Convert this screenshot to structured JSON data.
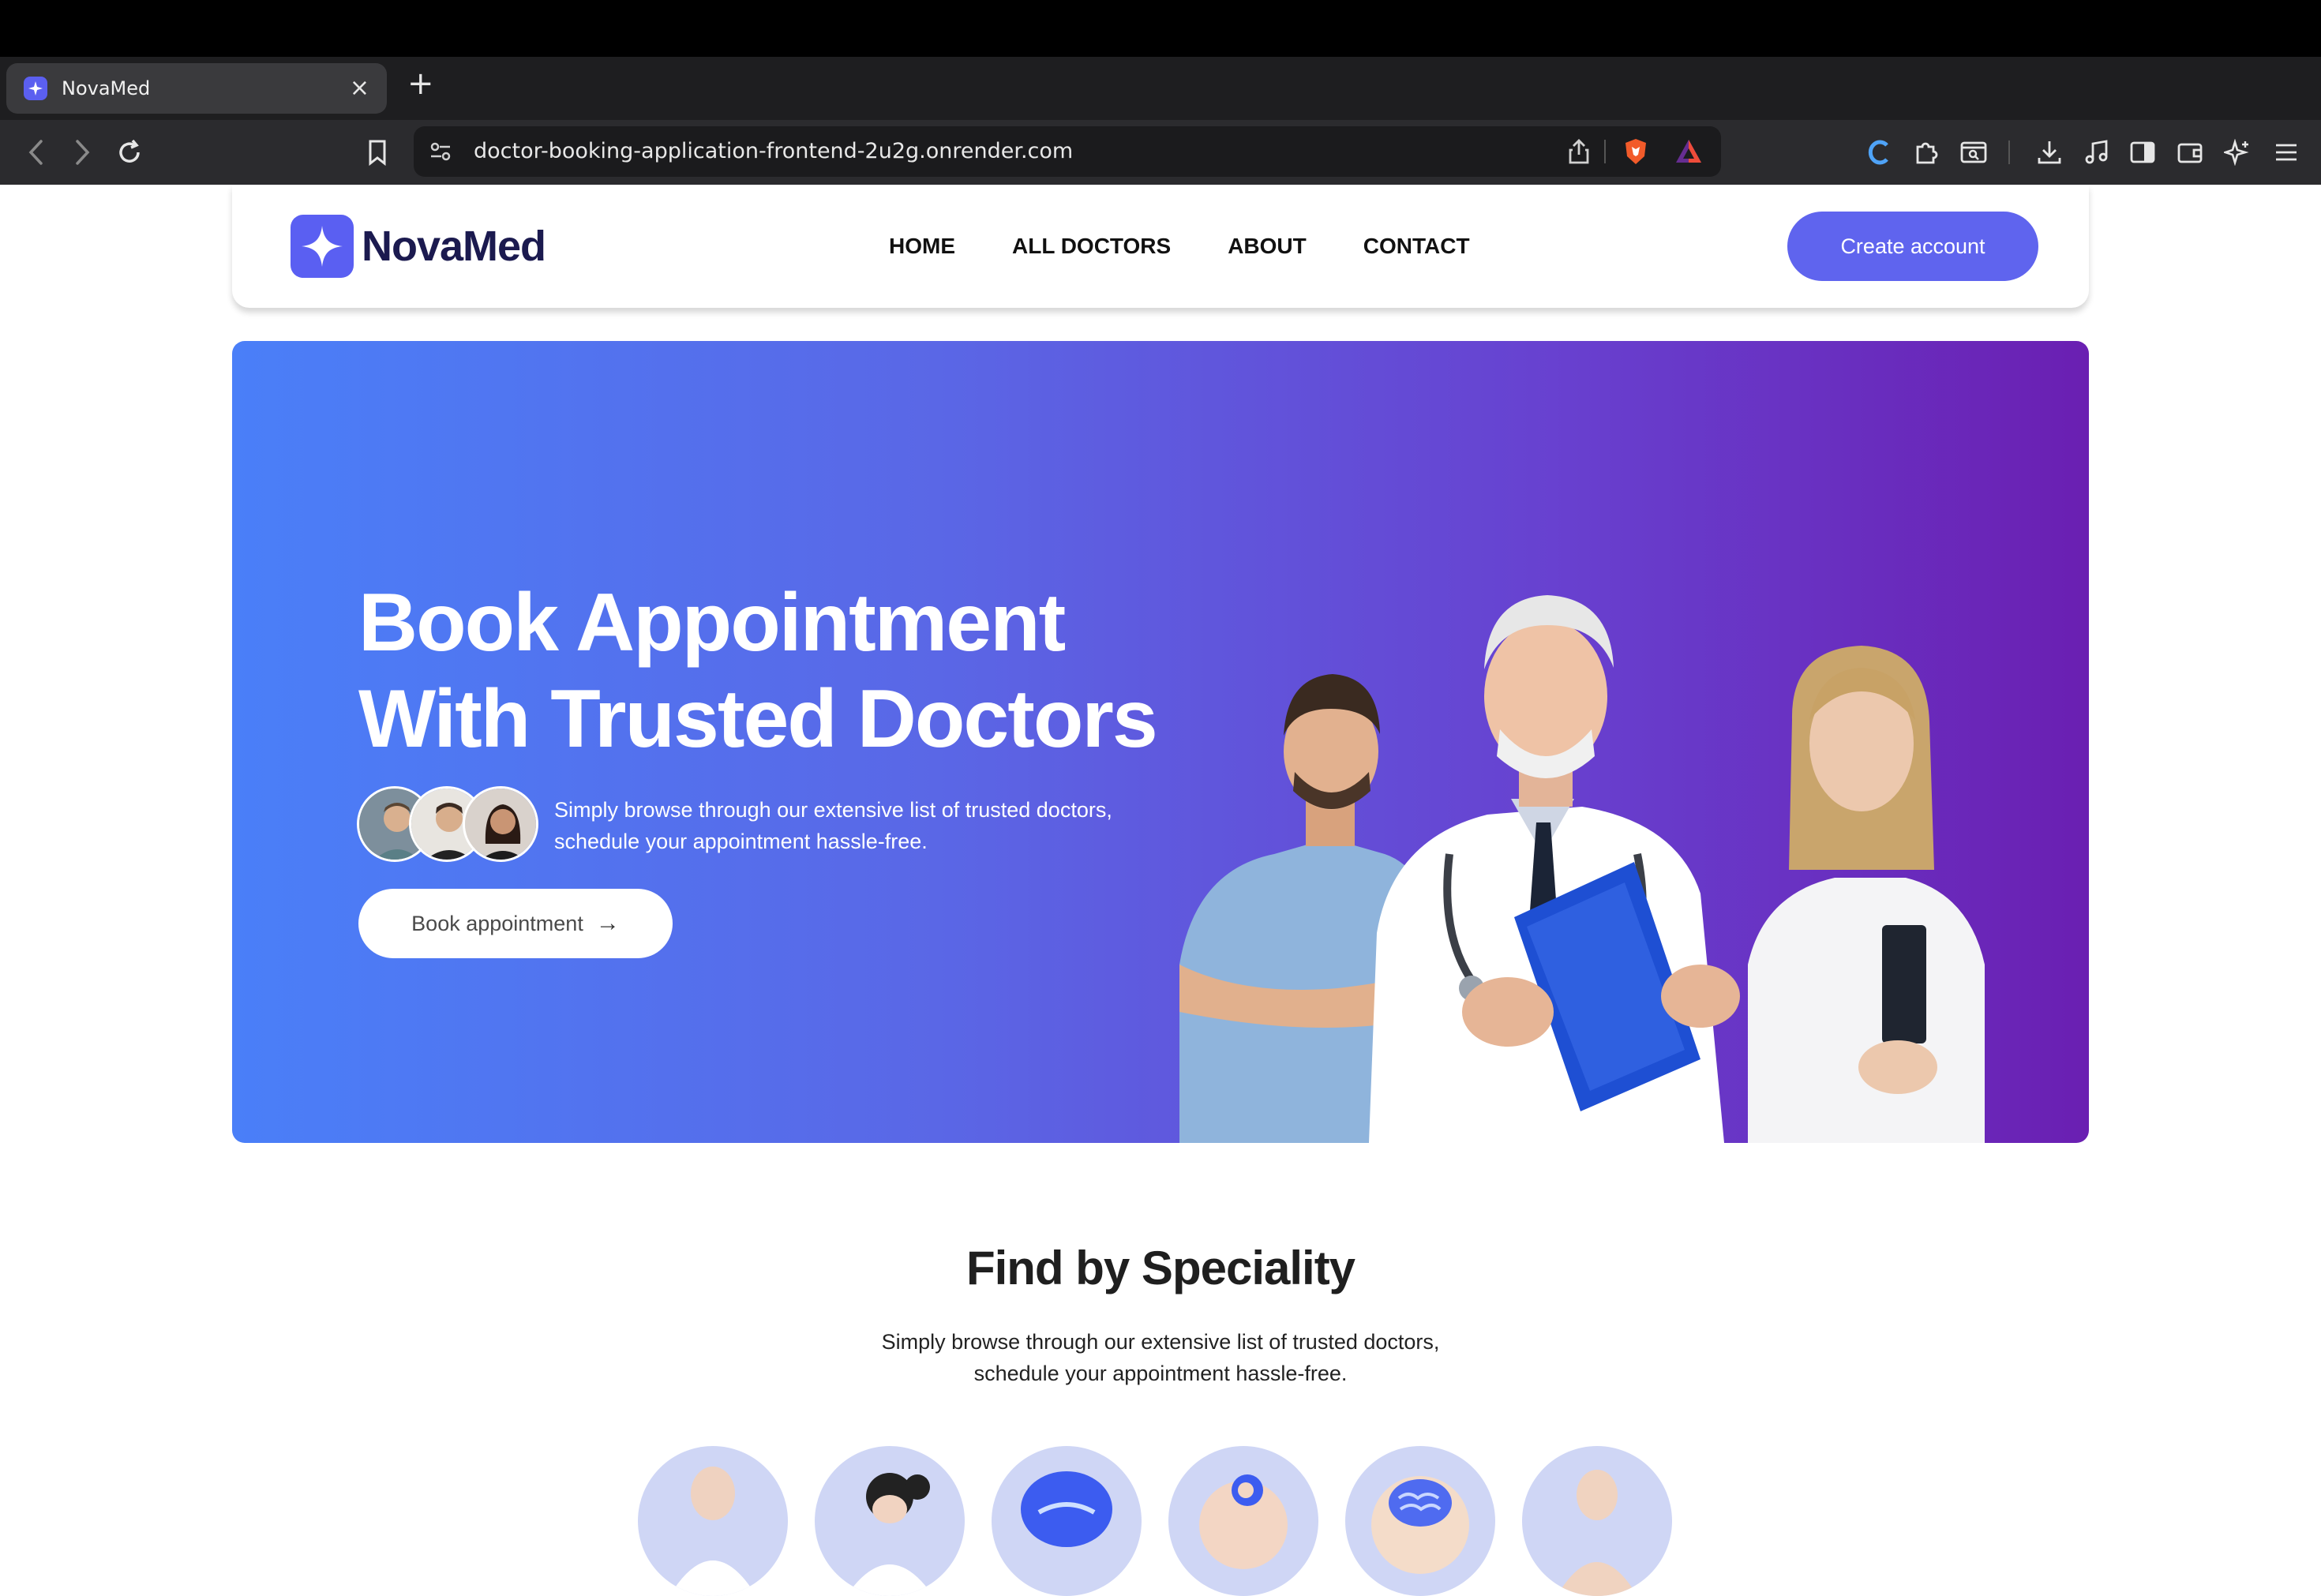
{
  "browser": {
    "tab_title": "NovaMed",
    "tab_close": "×",
    "new_tab": "+",
    "url": "doctor-booking-application-frontend-2u2g.onrender.com"
  },
  "nav": {
    "logo_text": "NovaMed",
    "links": [
      "HOME",
      "ALL DOCTORS",
      "ABOUT",
      "CONTACT"
    ],
    "cta": "Create account"
  },
  "hero": {
    "title_line1": "Book Appointment",
    "title_line2": "With Trusted Doctors",
    "subtitle_line1": "Simply browse through our extensive list of trusted doctors,",
    "subtitle_line2": "schedule your appointment hassle-free.",
    "button": "Book appointment",
    "button_arrow": "→"
  },
  "speciality": {
    "title": "Find by Speciality",
    "subtitle_line1": "Simply browse through our extensive list of trusted doctors,",
    "subtitle_line2": "schedule your appointment hassle-free.",
    "icons": [
      "physician-icon",
      "gynecologist-icon",
      "dermatologist-icon",
      "pediatrician-icon",
      "neurologist-icon",
      "gastroenterologist-icon"
    ]
  },
  "colors": {
    "brand": "#5f64ee",
    "hero_start": "#4a7ff8",
    "hero_end": "#6a1fb2",
    "logo_text": "#1b1a4f"
  }
}
